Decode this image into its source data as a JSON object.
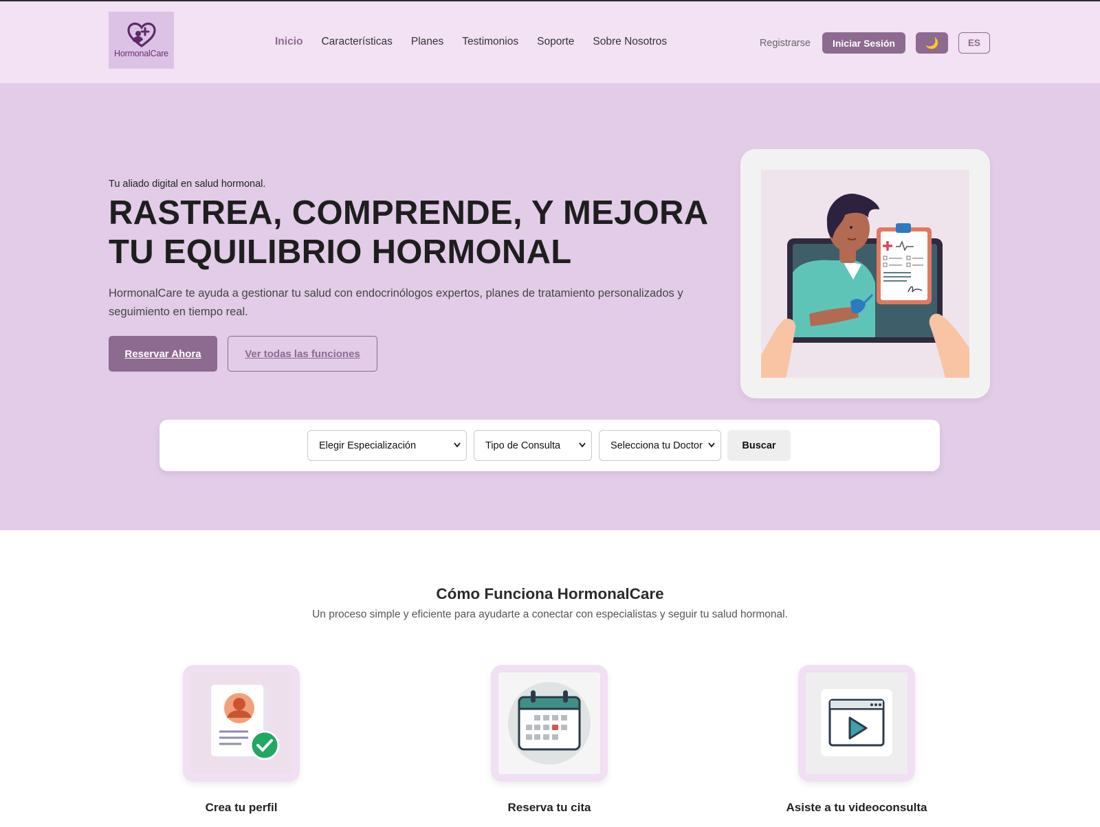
{
  "brand": {
    "name": "HormonalCare",
    "accent": "#8d6a8f",
    "nav_bg": "#f2e2f4",
    "hero_bg": "#e2cce8"
  },
  "nav": {
    "links": [
      {
        "label": "Inicio",
        "active": true
      },
      {
        "label": "Características"
      },
      {
        "label": "Planes"
      },
      {
        "label": "Testimonios"
      },
      {
        "label": "Soporte"
      },
      {
        "label": "Sobre Nosotros"
      }
    ],
    "register_label": "Registrarse",
    "login_label": "Iniciar Sesión",
    "theme_icon": "moon-icon",
    "theme_glyph": "🌙",
    "lang_label": "ES"
  },
  "hero": {
    "eyebrow": "Tu aliado digital en salud hormonal.",
    "title": "RASTREA, COMPRENDE, Y MEJORA TU EQUILIBRIO HORMONAL",
    "description": "HormonalCare te ayuda a gestionar tu salud con endocrinólogos expertos, planes de tratamiento personalizados y seguimiento en tiempo real.",
    "primary_cta": "Reservar Ahora",
    "secondary_cta": "Ver todas las funciones"
  },
  "search": {
    "specialization": "Elegir Especialización",
    "consult_type": "Tipo de Consulta",
    "doctor": "Selecciona tu Doctor",
    "button": "Buscar"
  },
  "how": {
    "title": "Cómo Funciona HormonalCare",
    "subtitle": "Un proceso simple y eficiente para ayudarte a conectar con especialistas y seguir tu salud hormonal.",
    "steps": [
      {
        "title": "Crea tu perfil",
        "icon": "profile-check-icon"
      },
      {
        "title": "Reserva tu cita",
        "icon": "calendar-icon"
      },
      {
        "title": "Asiste a tu videoconsulta",
        "icon": "video-play-icon"
      }
    ]
  }
}
